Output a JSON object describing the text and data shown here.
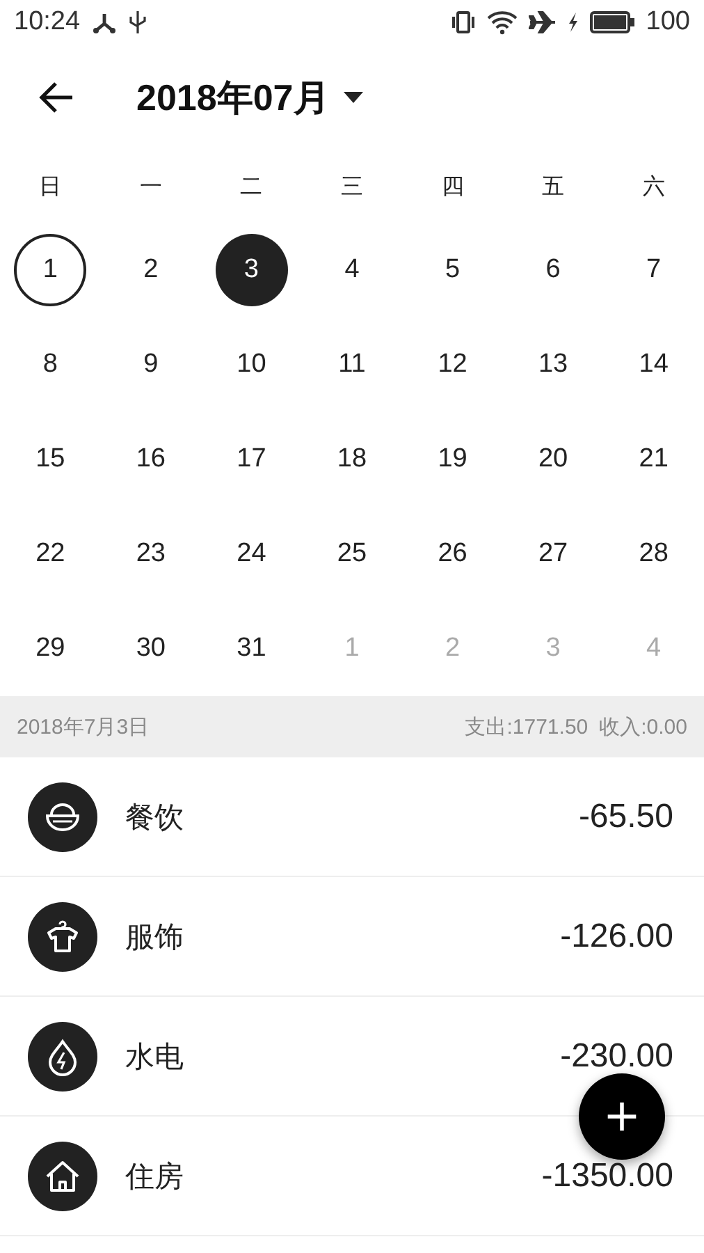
{
  "status_bar": {
    "time": "10:24",
    "battery": "100"
  },
  "header": {
    "title": "2018年07月"
  },
  "weekdays": [
    "日",
    "一",
    "二",
    "三",
    "四",
    "五",
    "六"
  ],
  "days": [
    {
      "label": "1",
      "today": true,
      "selected": false,
      "muted": false
    },
    {
      "label": "2",
      "today": false,
      "selected": false,
      "muted": false
    },
    {
      "label": "3",
      "today": false,
      "selected": true,
      "muted": false
    },
    {
      "label": "4",
      "today": false,
      "selected": false,
      "muted": false
    },
    {
      "label": "5",
      "today": false,
      "selected": false,
      "muted": false
    },
    {
      "label": "6",
      "today": false,
      "selected": false,
      "muted": false
    },
    {
      "label": "7",
      "today": false,
      "selected": false,
      "muted": false
    },
    {
      "label": "8",
      "today": false,
      "selected": false,
      "muted": false
    },
    {
      "label": "9",
      "today": false,
      "selected": false,
      "muted": false
    },
    {
      "label": "10",
      "today": false,
      "selected": false,
      "muted": false
    },
    {
      "label": "11",
      "today": false,
      "selected": false,
      "muted": false
    },
    {
      "label": "12",
      "today": false,
      "selected": false,
      "muted": false
    },
    {
      "label": "13",
      "today": false,
      "selected": false,
      "muted": false
    },
    {
      "label": "14",
      "today": false,
      "selected": false,
      "muted": false
    },
    {
      "label": "15",
      "today": false,
      "selected": false,
      "muted": false
    },
    {
      "label": "16",
      "today": false,
      "selected": false,
      "muted": false
    },
    {
      "label": "17",
      "today": false,
      "selected": false,
      "muted": false
    },
    {
      "label": "18",
      "today": false,
      "selected": false,
      "muted": false
    },
    {
      "label": "19",
      "today": false,
      "selected": false,
      "muted": false
    },
    {
      "label": "20",
      "today": false,
      "selected": false,
      "muted": false
    },
    {
      "label": "21",
      "today": false,
      "selected": false,
      "muted": false
    },
    {
      "label": "22",
      "today": false,
      "selected": false,
      "muted": false
    },
    {
      "label": "23",
      "today": false,
      "selected": false,
      "muted": false
    },
    {
      "label": "24",
      "today": false,
      "selected": false,
      "muted": false
    },
    {
      "label": "25",
      "today": false,
      "selected": false,
      "muted": false
    },
    {
      "label": "26",
      "today": false,
      "selected": false,
      "muted": false
    },
    {
      "label": "27",
      "today": false,
      "selected": false,
      "muted": false
    },
    {
      "label": "28",
      "today": false,
      "selected": false,
      "muted": false
    },
    {
      "label": "29",
      "today": false,
      "selected": false,
      "muted": false
    },
    {
      "label": "30",
      "today": false,
      "selected": false,
      "muted": false
    },
    {
      "label": "31",
      "today": false,
      "selected": false,
      "muted": false
    },
    {
      "label": "1",
      "today": false,
      "selected": false,
      "muted": true
    },
    {
      "label": "2",
      "today": false,
      "selected": false,
      "muted": true
    },
    {
      "label": "3",
      "today": false,
      "selected": false,
      "muted": true
    },
    {
      "label": "4",
      "today": false,
      "selected": false,
      "muted": true
    }
  ],
  "summary": {
    "date": "2018年7月3日",
    "expense": "支出:1771.50",
    "income": "收入:0.00"
  },
  "entries": [
    {
      "kind": "food",
      "name": "餐饮",
      "amount": "-65.50"
    },
    {
      "kind": "clothes",
      "name": "服饰",
      "amount": "-126.00"
    },
    {
      "kind": "utilities",
      "name": "水电",
      "amount": "-230.00"
    },
    {
      "kind": "housing",
      "name": "住房",
      "amount": "-1350.00"
    }
  ]
}
